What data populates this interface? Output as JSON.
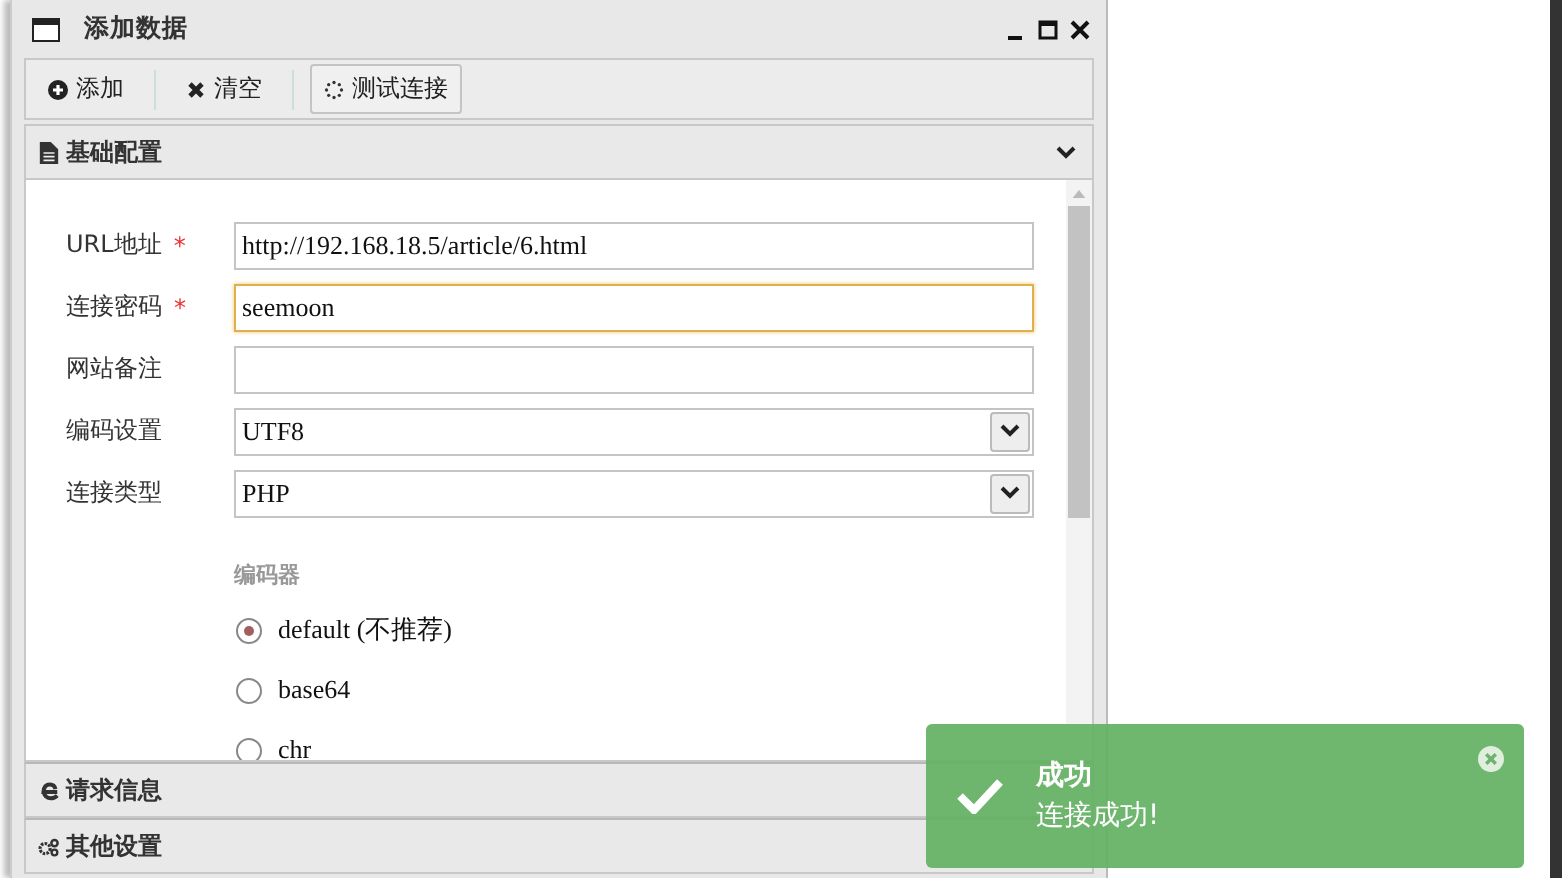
{
  "window": {
    "title": "添加数据"
  },
  "toolbar": [
    {
      "label": "添加",
      "selected": false
    },
    {
      "label": "清空",
      "selected": false
    },
    {
      "label": "测试连接",
      "selected": true
    }
  ],
  "sections": [
    {
      "title": "基础配置",
      "expanded": true
    },
    {
      "title": "请求信息",
      "expanded": false
    },
    {
      "title": "其他设置",
      "expanded": false
    }
  ],
  "fields": [
    {
      "kind": "text",
      "label": "URL地址",
      "required_mark": "*",
      "value": "http://192.168.18.5/article/6.html",
      "focused": false
    },
    {
      "kind": "text",
      "label": "连接密码",
      "required_mark": "*",
      "value": "seemoon",
      "focused": true
    },
    {
      "kind": "text",
      "label": "网站备注",
      "focused": false
    },
    {
      "kind": "select",
      "label": "编码设置",
      "value": "UTF8",
      "focused": false
    },
    {
      "kind": "select",
      "label": "连接类型",
      "value": "PHP",
      "focused": false
    }
  ],
  "encoder": {
    "label": "编码器",
    "options": [
      {
        "label": "default (不推荐)",
        "selected": true
      },
      {
        "label": "base64",
        "selected": false
      },
      {
        "label": "chr",
        "selected": false
      }
    ]
  },
  "toast": {
    "title": "成功",
    "message": "连接成功!"
  }
}
